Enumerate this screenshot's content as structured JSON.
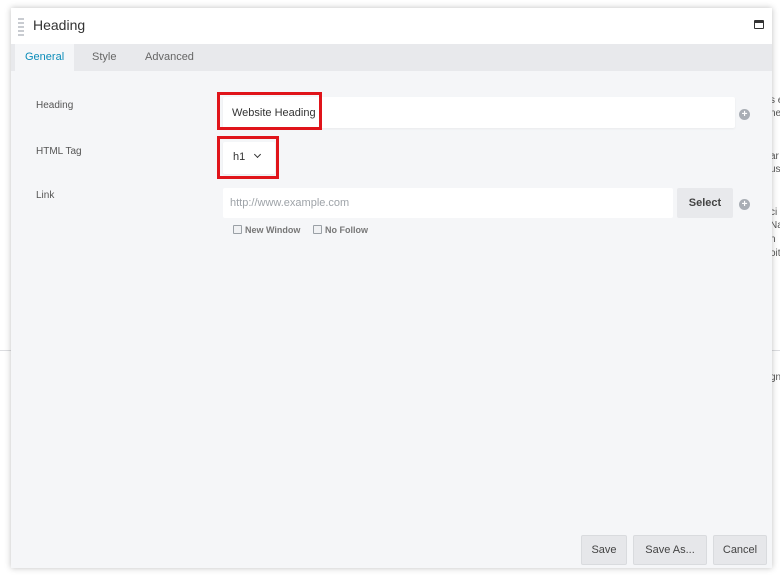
{
  "background_page": {
    "fragments": [
      {
        "text": "s e"
      },
      {
        "text": "ne"
      },
      {
        "text": "ar"
      },
      {
        "text": "us"
      },
      {
        "text": "ci"
      },
      {
        "text": "Na"
      },
      {
        "text": "n"
      },
      {
        "text": "oit"
      },
      {
        "text": "gn"
      }
    ]
  },
  "modal": {
    "title": "Heading"
  },
  "tabs": [
    {
      "label": "General",
      "active": true
    },
    {
      "label": "Style",
      "active": false
    },
    {
      "label": "Advanced",
      "active": false
    }
  ],
  "fields": {
    "heading": {
      "label": "Heading",
      "value": "Website Heading"
    },
    "html_tag": {
      "label": "HTML Tag",
      "value": "h1"
    },
    "link": {
      "label": "Link",
      "value": "",
      "placeholder": "http://www.example.com",
      "select_label": "Select",
      "new_window_label": "New Window",
      "no_follow_label": "No Follow"
    }
  },
  "footer": {
    "save_label": "Save",
    "save_as_label": "Save As...",
    "cancel_label": "Cancel"
  },
  "colors": {
    "accent": "#0b8cb9",
    "highlight": "#e0141a"
  },
  "icons": {
    "plus": "+"
  }
}
